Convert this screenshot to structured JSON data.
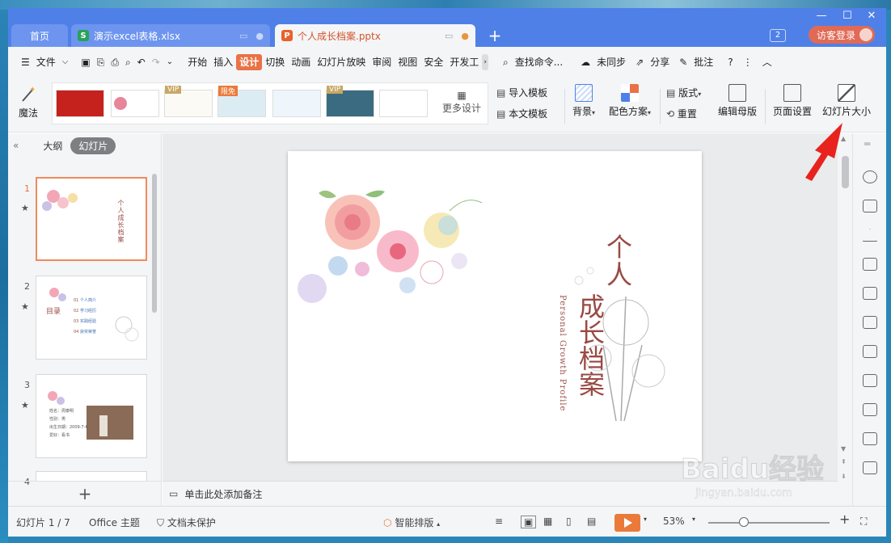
{
  "tabs": {
    "home": "首页",
    "xlsx": "演示excel表格.xlsx",
    "pptx": "个人成长档案.pptx",
    "new_tab": "+",
    "badge_count": "2",
    "login": "访客登录"
  },
  "menu": {
    "file": "文件",
    "items": [
      "开始",
      "插入",
      "设计",
      "切换",
      "动画",
      "幻灯片放映",
      "审阅",
      "视图",
      "安全",
      "开发工"
    ],
    "active_item": "设计",
    "search": "查找命令...",
    "sync": "未同步",
    "share": "分享",
    "comment": "批注"
  },
  "ribbon": {
    "magic": "魔法",
    "more_designs": "更多设计",
    "import_template": "导入模板",
    "this_template": "本文模板",
    "background": "背景",
    "color_scheme": "配色方案",
    "layout": "版式",
    "reset": "重置",
    "edit_master": "编辑母版",
    "page_setup": "页面设置",
    "slide_size": "幻灯片大小",
    "badges": {
      "vip": "VIP",
      "free": "限免"
    }
  },
  "left_panel": {
    "outline_tab": "大纲",
    "slides_tab": "幻灯片",
    "slide_numbers": [
      "1",
      "2",
      "3",
      "4"
    ],
    "thumb2": {
      "title": "目录",
      "items": [
        "个人简介",
        "学习经历",
        "实践经验",
        "获奖荣誉"
      ],
      "nums": [
        "01",
        "02",
        "03",
        "04"
      ]
    },
    "thumb3": {
      "lines": [
        "姓名：周泰明",
        "性别：男",
        "出生日期：2009-7-6",
        "爱好：看书"
      ]
    },
    "thumb1_title": "个人成长档案"
  },
  "slide": {
    "title_line1": "个人",
    "title_line2": "成长档案",
    "subtitle": "Personal Growth Profile"
  },
  "notes_placeholder": "单击此处添加备注",
  "status": {
    "slide_count": "幻灯片 1 / 7",
    "theme": "Office 主题",
    "protection": "文档未保护",
    "smart_layout": "智能排版",
    "zoom": "53%",
    "zoom_level": 0.53
  },
  "watermark": {
    "brand": "Baidu经验",
    "url": "jingyan.baidu.com"
  },
  "colors": {
    "accent": "#e97246",
    "tabbar": "#4f80e8",
    "pptx_tab": "#d2552a",
    "title": "#9a4a44"
  }
}
